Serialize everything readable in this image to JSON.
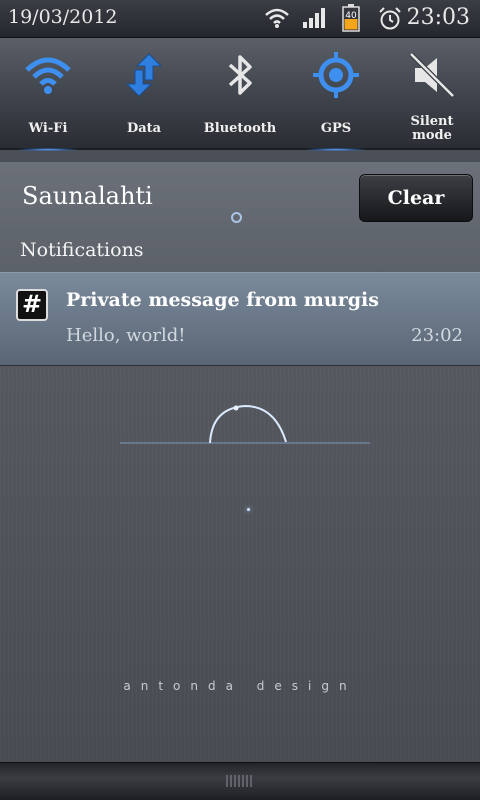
{
  "status_bar": {
    "date": "19/03/2012",
    "time": "23:03",
    "battery_level": "40",
    "icons": [
      "wifi-icon",
      "signal-icon",
      "battery-icon",
      "alarm-icon"
    ]
  },
  "toggles": [
    {
      "label": "Wi-Fi",
      "icon": "wifi-icon"
    },
    {
      "label": "Data",
      "icon": "data-arrows-icon"
    },
    {
      "label": "Bluetooth",
      "icon": "bluetooth-icon"
    },
    {
      "label": "GPS",
      "icon": "gps-icon"
    },
    {
      "label_line1": "Silent",
      "label_line2": "mode",
      "icon": "silent-mode-icon"
    }
  ],
  "header": {
    "carrier": "Saunalahti",
    "clear_label": "Clear",
    "section_title": "Notifications"
  },
  "notification": {
    "icon": "hash-icon",
    "icon_glyph": "#",
    "title": "Private message from murgis",
    "text": "Hello, world!",
    "time": "23:02"
  },
  "wallpaper": {
    "brand": "antonda design"
  },
  "colors": {
    "accent_blue": "#3b82e6",
    "notification_bg": "#6c7b8c"
  }
}
